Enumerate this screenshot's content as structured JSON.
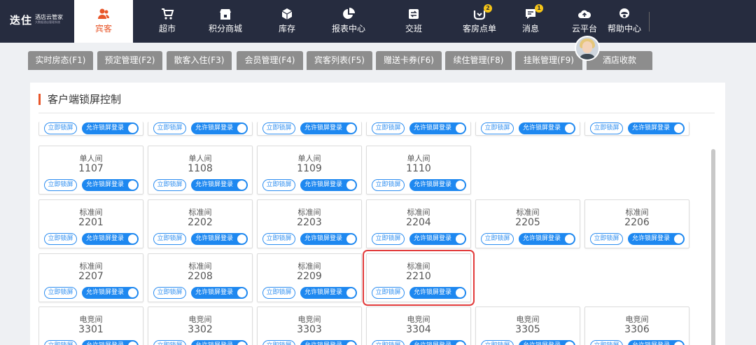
{
  "app": {
    "logo_main": "迭住",
    "logo_sub": "酒店云管家",
    "logo_tiny": "大数据酒店管理系统"
  },
  "nav": [
    {
      "label": "宾客",
      "icon": "guests-icon",
      "active": true
    },
    {
      "label": "超市",
      "icon": "cart-icon"
    },
    {
      "label": "积分商城",
      "icon": "store-icon"
    },
    {
      "label": "库存",
      "icon": "box-icon"
    },
    {
      "label": "报表中心",
      "icon": "pie-chart-icon"
    },
    {
      "label": "交班",
      "icon": "shift-icon"
    },
    {
      "label": "客房点单",
      "icon": "order-icon",
      "badge": "2"
    },
    {
      "label": "消息",
      "icon": "message-icon",
      "badge": "1"
    },
    {
      "label": "云平台",
      "icon": "cloud-icon"
    },
    {
      "label": "帮助中心",
      "icon": "headset-icon"
    }
  ],
  "tabs": [
    "实时房态(F1)",
    "预定管理(F2)",
    "散客入住(F3)",
    "会员管理(F4)",
    "宾客列表(F5)",
    "赠送卡券(F6)",
    "续住管理(F8)",
    "挂账管理(F9)",
    "酒店收款"
  ],
  "panel": {
    "title": "客户端锁屏控制"
  },
  "controls": {
    "lock_label": "立即锁屏",
    "allow_label": "允许锁屏登录"
  },
  "rows": [
    {
      "partial": true,
      "rooms": [
        {
          "type": "",
          "number": ""
        },
        {
          "type": "",
          "number": ""
        },
        {
          "type": "",
          "number": ""
        },
        {
          "type": "",
          "number": ""
        },
        {
          "type": "",
          "number": ""
        },
        {
          "type": "",
          "number": ""
        }
      ]
    },
    {
      "rooms": [
        {
          "type": "单人间",
          "number": "1107"
        },
        {
          "type": "单人间",
          "number": "1108"
        },
        {
          "type": "单人间",
          "number": "1109"
        },
        {
          "type": "单人间",
          "number": "1110"
        }
      ]
    },
    {
      "rooms": [
        {
          "type": "标准间",
          "number": "2201"
        },
        {
          "type": "标准间",
          "number": "2202"
        },
        {
          "type": "标准间",
          "number": "2203"
        },
        {
          "type": "标准间",
          "number": "2204"
        },
        {
          "type": "标准间",
          "number": "2205"
        },
        {
          "type": "标准间",
          "number": "2206"
        }
      ]
    },
    {
      "rooms": [
        {
          "type": "标准间",
          "number": "2207"
        },
        {
          "type": "标准间",
          "number": "2208"
        },
        {
          "type": "标准间",
          "number": "2209"
        },
        {
          "type": "标准间",
          "number": "2210",
          "selected": true
        }
      ]
    },
    {
      "rooms": [
        {
          "type": "电竞间",
          "number": "3301"
        },
        {
          "type": "电竞间",
          "number": "3302"
        },
        {
          "type": "电竞间",
          "number": "3303"
        },
        {
          "type": "电竞间",
          "number": "3304"
        },
        {
          "type": "电竞间",
          "number": "3305"
        },
        {
          "type": "电竞间",
          "number": "3306"
        }
      ]
    }
  ],
  "colors": {
    "accent": "#e8562a",
    "nav_bg": "#262c3f",
    "toggle": "#1e88f0",
    "selection": "#e23b3b"
  }
}
